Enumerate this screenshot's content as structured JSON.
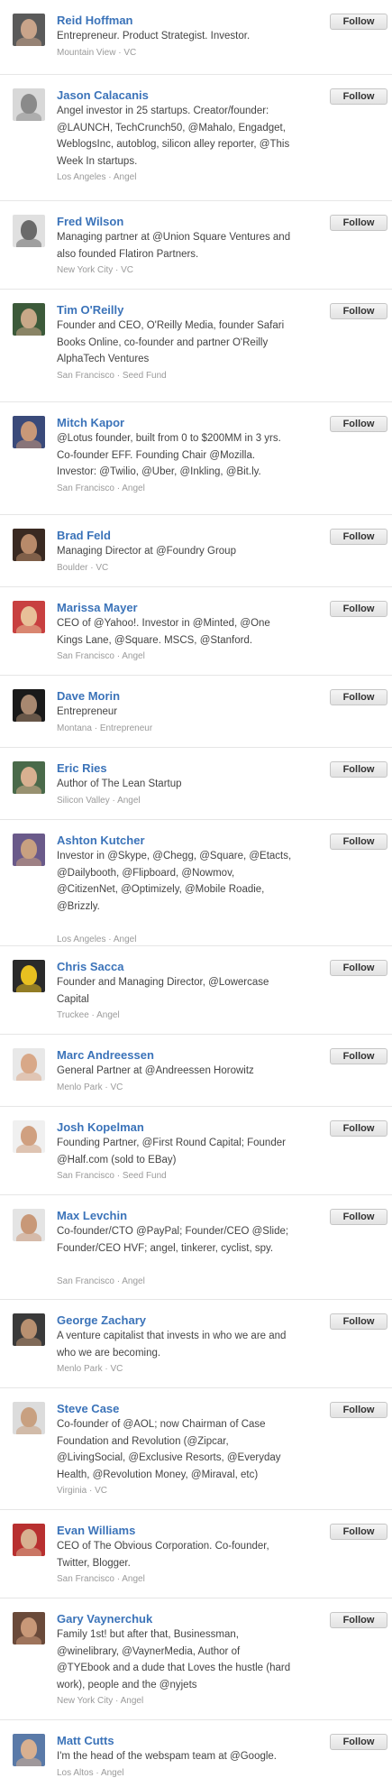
{
  "follow_label": "Follow",
  "people": [
    {
      "name": "Reid Hoffman",
      "bio": "Entrepreneur. Product Strategist. Investor.",
      "location": "Mountain View",
      "role": "VC",
      "avatar_bg": "#5a5a5a",
      "avatar_fg": "#c9a48a"
    },
    {
      "name": "Jason Calacanis",
      "bio": "Angel investor in 25 startups. Creator/founder: @LAUNCH, TechCrunch50, @Mahalo, Engadget, WeblogsInc, autoblog, silicon alley reporter, @This Week In startups.",
      "location": "Los Angeles",
      "role": "Angel",
      "avatar_bg": "#d8d8d8",
      "avatar_fg": "#8a8a8a"
    },
    {
      "name": "Fred Wilson",
      "bio": "Managing partner at @Union Square Ventures and also founded Flatiron Partners.",
      "location": "New York City",
      "role": "VC",
      "avatar_bg": "#e0e0e0",
      "avatar_fg": "#6a6a6a"
    },
    {
      "name": "Tim O'Reilly",
      "bio": "Founder and CEO, O'Reilly Media, founder Safari Books Online, co-founder and partner O'Reilly AlphaTech Ventures",
      "location": "San Francisco",
      "role": "Seed Fund",
      "avatar_bg": "#3c5a3a",
      "avatar_fg": "#c8a888"
    },
    {
      "name": "Mitch Kapor",
      "bio": "@Lotus founder, built from 0 to $200MM in 3 yrs. Co-founder EFF. Founding Chair @Mozilla. Investor: @Twilio, @Uber, @Inkling, @Bit.ly.",
      "location": "San Francisco",
      "role": "Angel",
      "avatar_bg": "#3a4a7a",
      "avatar_fg": "#c89878"
    },
    {
      "name": "Brad Feld",
      "bio": "Managing Director at @Foundry Group",
      "location": "Boulder",
      "role": "VC",
      "avatar_bg": "#3a2a22",
      "avatar_fg": "#b88a6a"
    },
    {
      "name": "Marissa Mayer",
      "bio": "CEO of @Yahoo!. Investor in @Minted, @One Kings Lane, @Square. MSCS, @Stanford.",
      "location": "San Francisco",
      "role": "Angel",
      "avatar_bg": "#c84040",
      "avatar_fg": "#e8c098"
    },
    {
      "name": "Dave Morin",
      "bio": "Entrepreneur",
      "location": "Montana",
      "role": "Entrepreneur",
      "avatar_bg": "#1a1a1a",
      "avatar_fg": "#a88870"
    },
    {
      "name": "Eric Ries",
      "bio": "Author of The Lean Startup",
      "location": "Silicon Valley",
      "role": "Angel",
      "avatar_bg": "#4a6a4a",
      "avatar_fg": "#d8b090"
    },
    {
      "name": "Ashton Kutcher",
      "bio": "Investor in @Skype, @Chegg, @Square, @Etacts, @Dailybooth, @Flipboard, @Nowmov, @CitizenNet, @Optimizely, @Mobile Roadie, @Brizzly.",
      "location": "Los Angeles",
      "role": "Angel",
      "avatar_bg": "#6a5a8a",
      "avatar_fg": "#c8a080"
    },
    {
      "name": "Chris Sacca",
      "bio": "Founder and Managing Director, @Lowercase Capital",
      "location": "Truckee",
      "role": "Angel",
      "avatar_bg": "#2a2a2a",
      "avatar_fg": "#e8c020"
    },
    {
      "name": "Marc Andreessen",
      "bio": "General Partner at @Andreessen Horowitz",
      "location": "Menlo Park",
      "role": "VC",
      "avatar_bg": "#e8e8e8",
      "avatar_fg": "#d8a888"
    },
    {
      "name": "Josh Kopelman",
      "bio": "Founding Partner, @First Round Capital; Founder @Half.com (sold to EBay)",
      "location": "San Francisco",
      "role": "Seed Fund",
      "avatar_bg": "#f0f0f0",
      "avatar_fg": "#d0a080"
    },
    {
      "name": "Max Levchin",
      "bio": "Co-founder/CTO @PayPal; Founder/CEO @Slide; Founder/CEO HVF; angel, tinkerer, cyclist, spy.",
      "location": "San Francisco",
      "role": "Angel",
      "avatar_bg": "#e4e4e4",
      "avatar_fg": "#c89878"
    },
    {
      "name": "George Zachary",
      "bio": "A venture capitalist that invests in who we are and who we are becoming.",
      "location": "Menlo Park",
      "role": "VC",
      "avatar_bg": "#3a3a3a",
      "avatar_fg": "#b89070"
    },
    {
      "name": "Steve Case",
      "bio": "Co-founder of @AOL; now Chairman of Case Foundation and Revolution (@Zipcar, @LivingSocial, @Exclusive Resorts, @Everyday Health, @Revolution Money, @Miraval, etc)",
      "location": "Virginia",
      "role": "VC",
      "avatar_bg": "#dcdcdc",
      "avatar_fg": "#c8a080"
    },
    {
      "name": "Evan Williams",
      "bio": "CEO of The Obvious Corporation. Co-founder, Twitter, Blogger.",
      "location": "San Francisco",
      "role": "Angel",
      "avatar_bg": "#b83030",
      "avatar_fg": "#d8b090"
    },
    {
      "name": "Gary Vaynerchuk",
      "bio": "Family 1st! but after that, Businessman, @winelibrary, @VaynerMedia, Author of @TYEbook and a dude that Loves the hustle (hard work), people and the @nyjets",
      "location": "New York City",
      "role": "Angel",
      "avatar_bg": "#6a4a3a",
      "avatar_fg": "#c89878"
    },
    {
      "name": "Matt Cutts",
      "bio": "I'm the head of the webspam team at @Google.",
      "location": "Los Altos",
      "role": "Angel",
      "avatar_bg": "#5a7aa8",
      "avatar_fg": "#d8b090"
    }
  ]
}
